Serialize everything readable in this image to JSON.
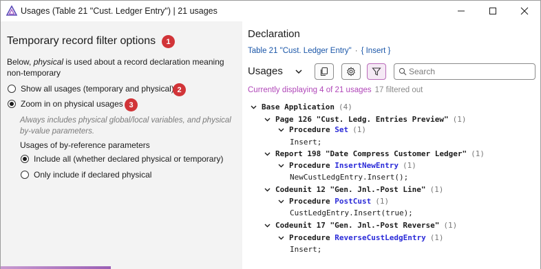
{
  "window": {
    "title": "Usages (Table 21 \"Cust. Ledger Entry\") | 21 usages",
    "icons": {
      "app": "app-logo-icon",
      "minimize": "minimize-icon",
      "maximize": "maximize-icon",
      "close": "close-icon"
    }
  },
  "left": {
    "title": "Temporary record filter options",
    "description_pre": "Below, ",
    "description_em": "physical",
    "description_post": " is used about a record declaration meaning non-temporary",
    "badges": [
      "1",
      "2",
      "3"
    ],
    "option_all": "Show all usages (temporary and physical)",
    "option_physical": "Zoom in on physical usages",
    "selected_option": "option_physical",
    "hint": "Always includes physical global/local variables, and physical by-value parameters.",
    "byref_label": "Usages of by-reference parameters",
    "byref_include_all": "Include all (whether declared physical or temporary)",
    "byref_only_physical": "Only include if declared physical",
    "byref_selected": "byref_include_all"
  },
  "right": {
    "declaration_title": "Declaration",
    "declaration_link": "Table 21 \"Cust. Ledger Entry\"",
    "declaration_sep": "·",
    "declaration_trigger": "{ Insert }",
    "usages_title": "Usages",
    "toolbar": {
      "copy_icon": "copy-icon",
      "settings_icon": "gear-icon",
      "filter_icon": "filter-icon",
      "filter_active": true
    },
    "search_placeholder": "Search",
    "status_main": "Currently displaying 4 of 21 usages",
    "status_filtered": "17 filtered out",
    "tree": {
      "root": {
        "label": "Base Application",
        "count": "(4)"
      },
      "objects": [
        {
          "label": "Page 126 \"Cust. Ledg. Entries Preview\"",
          "count": "(1)",
          "kw": "Procedure",
          "proc": "Set",
          "proc_count": "(1)",
          "code": "Insert;"
        },
        {
          "label": "Report 198 \"Date Compress Customer Ledger\"",
          "count": "(1)",
          "kw": "Procedure",
          "proc": "InsertNewEntry",
          "proc_count": "(1)",
          "code": "NewCustLedgEntry.Insert();"
        },
        {
          "label": "Codeunit 12 \"Gen. Jnl.-Post Line\"",
          "count": "(1)",
          "kw": "Procedure",
          "proc": "PostCust",
          "proc_count": "(1)",
          "code": "CustLedgEntry.Insert(true);"
        },
        {
          "label": "Codeunit 17 \"Gen. Jnl.-Post Reverse\"",
          "count": "(1)",
          "kw": "Procedure",
          "proc": "ReverseCustLedgEntry",
          "proc_count": "(1)",
          "code": "Insert;"
        }
      ]
    }
  },
  "colors": {
    "accent_purple": "#b046b8",
    "link_blue": "#1a56a8",
    "badge_red": "#d13438",
    "proc_blue": "#2a2ad8"
  }
}
